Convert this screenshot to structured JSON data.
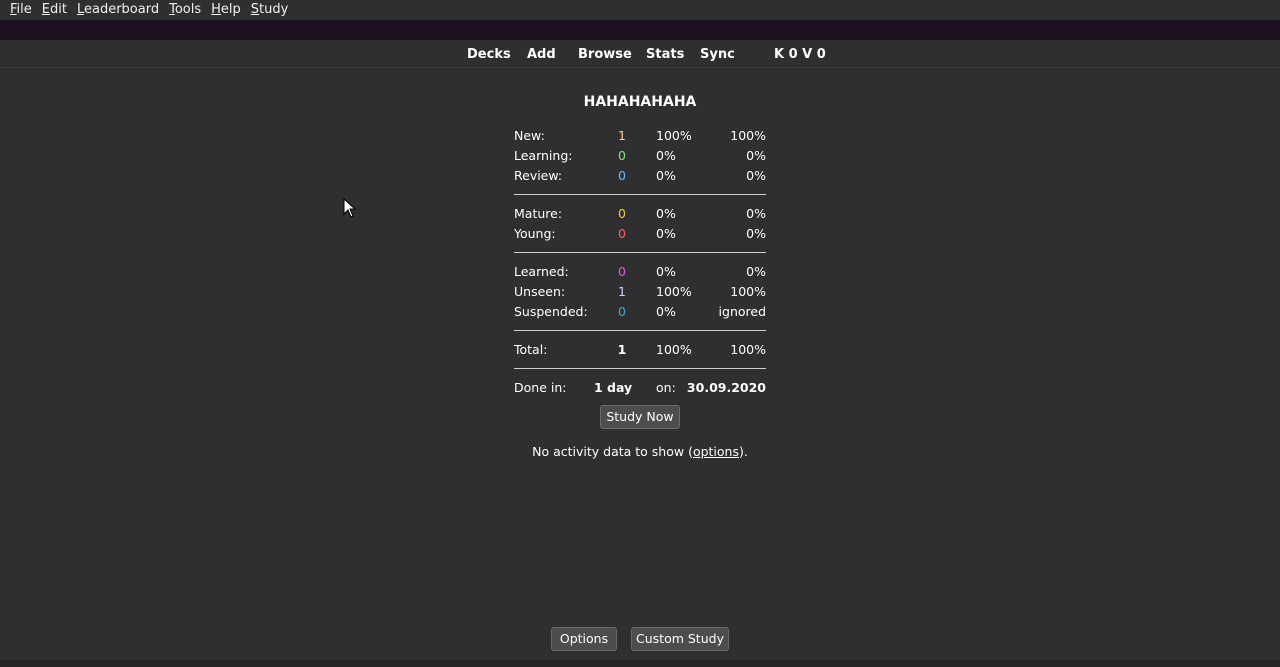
{
  "menu": [
    {
      "key": "F",
      "rest": "ile"
    },
    {
      "key": "E",
      "rest": "dit"
    },
    {
      "key": "L",
      "rest": "eaderboard"
    },
    {
      "key": "T",
      "rest": "ools"
    },
    {
      "key": "H",
      "rest": "elp"
    },
    {
      "key": "S",
      "rest": "tudy"
    }
  ],
  "toolbar": {
    "decks": "Decks",
    "add": "Add",
    "browse": "Browse",
    "stats": "Stats",
    "sync": "Sync",
    "profile": "K 0 V 0"
  },
  "deck_title": "HAHAHAHAHA",
  "stats": {
    "new": {
      "label": "New:",
      "count": "1",
      "p1": "100%",
      "p2": "100%"
    },
    "learning": {
      "label": "Learning:",
      "count": "0",
      "p1": "0%",
      "p2": "0%"
    },
    "review": {
      "label": "Review:",
      "count": "0",
      "p1": "0%",
      "p2": "0%"
    },
    "mature": {
      "label": "Mature:",
      "count": "0",
      "p1": "0%",
      "p2": "0%"
    },
    "young": {
      "label": "Young:",
      "count": "0",
      "p1": "0%",
      "p2": "0%"
    },
    "learned": {
      "label": "Learned:",
      "count": "0",
      "p1": "0%",
      "p2": "0%"
    },
    "unseen": {
      "label": "Unseen:",
      "count": "1",
      "p1": "100%",
      "p2": "100%"
    },
    "suspended": {
      "label": "Suspended:",
      "count": "0",
      "p1": "0%",
      "p2": "ignored"
    },
    "total": {
      "label": "Total:",
      "count": "1",
      "p1": "100%",
      "p2": "100%"
    },
    "done": {
      "label": "Done in:",
      "value": "1 day",
      "on": "on:",
      "date": "30.09.2020"
    }
  },
  "colors": {
    "new": "#ffd0a8",
    "learning": "#8be08b",
    "review": "#6fb6ff",
    "mature": "#f2c94c",
    "young": "#ff5a6e",
    "learned": "#e35ad6",
    "unseen": "#d7d2ff",
    "suspended": "#4fa3c7"
  },
  "buttons": {
    "study_now": "Study Now",
    "options": "Options",
    "custom_study": "Custom Study"
  },
  "activity": {
    "prefix": "No activity data to show (",
    "link": "options",
    "suffix": ")."
  }
}
